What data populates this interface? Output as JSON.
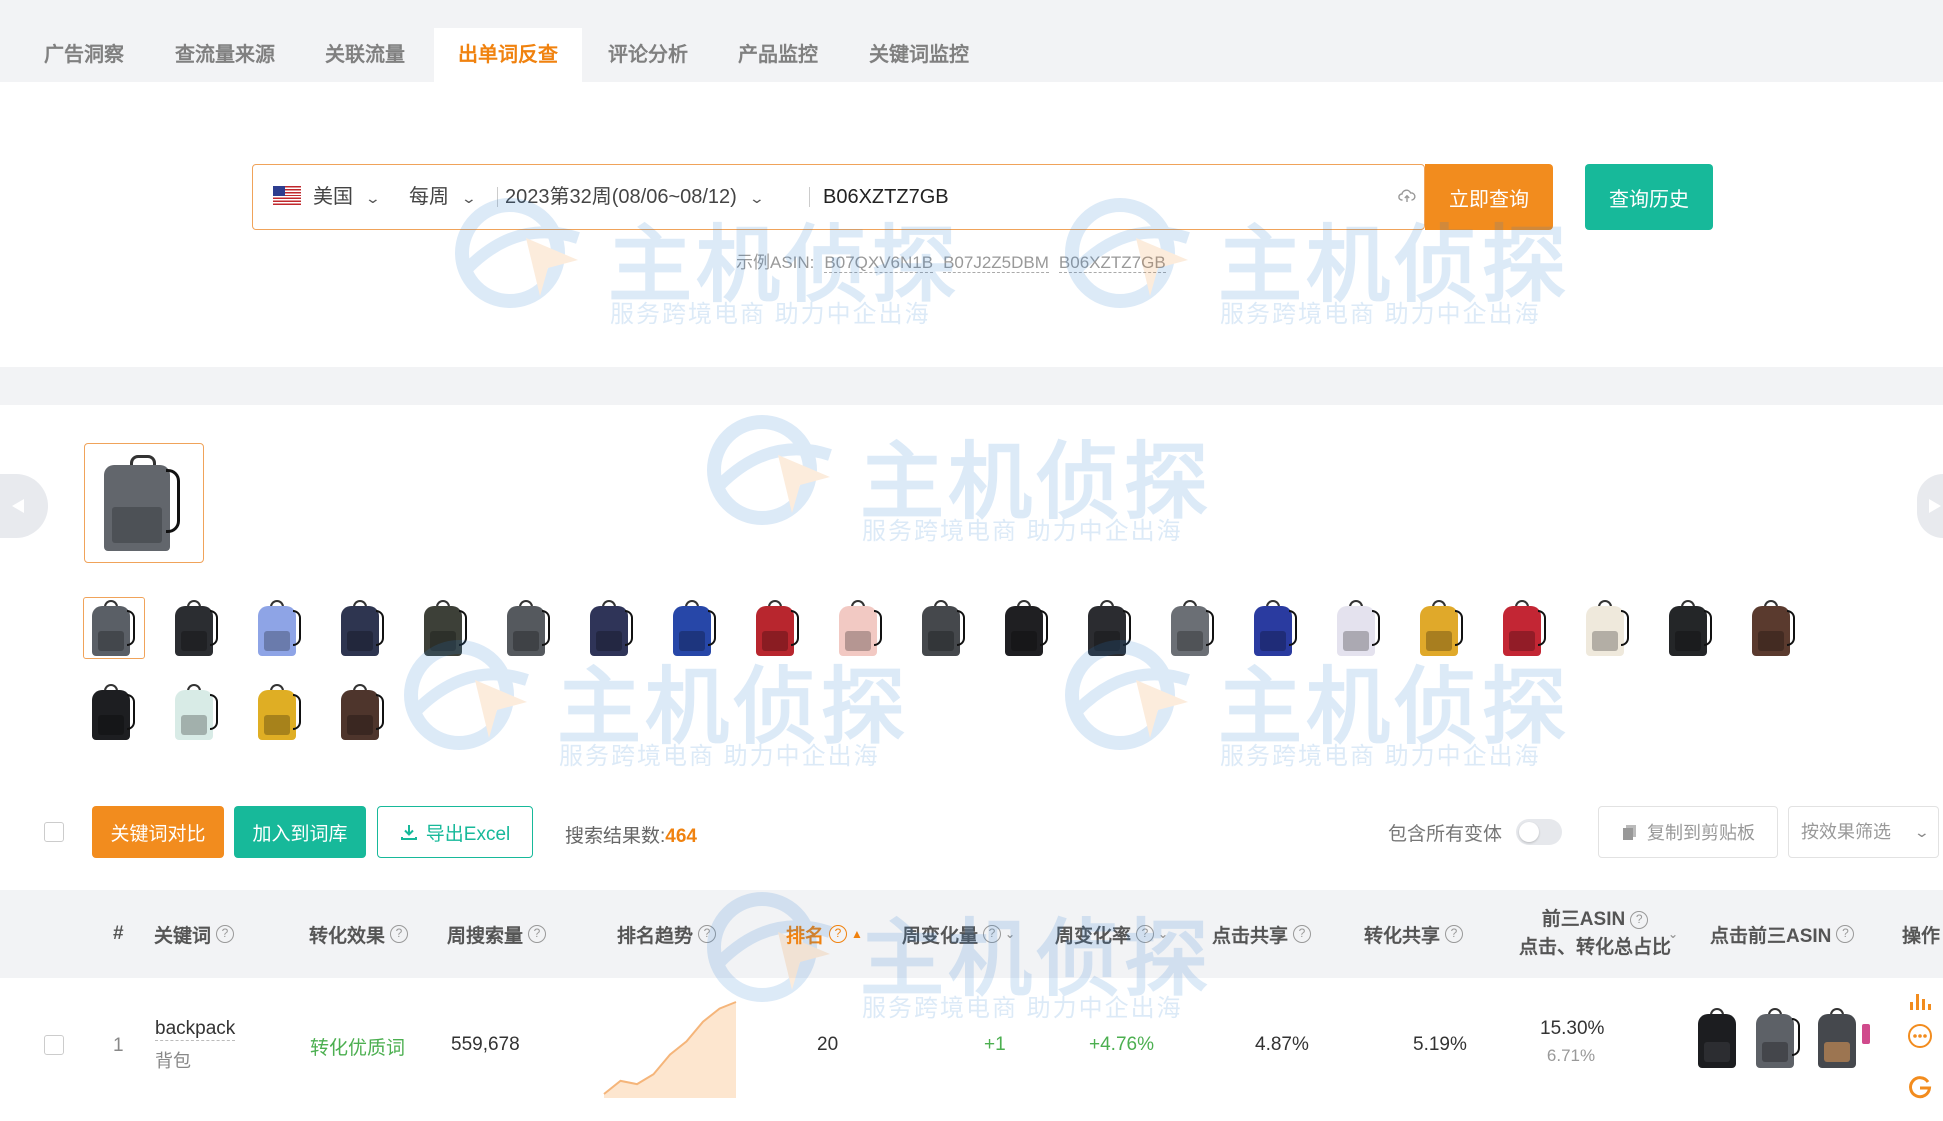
{
  "tabs": [
    {
      "label": "广告洞察",
      "active": false
    },
    {
      "label": "查流量来源",
      "active": false
    },
    {
      "label": "关联流量",
      "active": false
    },
    {
      "label": "出单词反查",
      "active": true
    },
    {
      "label": "评论分析",
      "active": false
    },
    {
      "label": "产品监控",
      "active": false
    },
    {
      "label": "关键词监控",
      "active": false
    }
  ],
  "search": {
    "country": "美国",
    "period": "每周",
    "week": "2023第32周(08/06~08/12)",
    "asin_value": "B06XZTZ7GB",
    "query_button": "立即查询",
    "history_button": "查询历史",
    "examples_label": "示例ASIN:",
    "examples": [
      "B07QXV6N1B",
      "B07J2Z5DBM",
      "B06XZTZ7GB"
    ]
  },
  "watermark": {
    "title": "主机侦探",
    "subtitle": "服务跨境电商  助力中企出海"
  },
  "variant_colors": [
    "#5a5f66",
    "#2b2d31",
    "#8ea4e6",
    "#2e3550",
    "#3d4038",
    "#55595e",
    "#2f3458",
    "#2747a8",
    "#b8262e",
    "#f2c9c3",
    "#45484c",
    "#1f1f22",
    "#2b2c30",
    "#6b6f75",
    "#2a3ba0",
    "#e4e2ee",
    "#e0a92a",
    "#c32634",
    "#efe9dc",
    "#242628",
    "#5a3a2e",
    "#1d1e21",
    "#d8ebe6",
    "#dfae24",
    "#4e352c"
  ],
  "toolbar": {
    "compare": "关键词对比",
    "add_to_library": "加入到词库",
    "export": "导出Excel",
    "result_label": "搜索结果数:",
    "result_count": "464",
    "include_variants": "包含所有变体",
    "copy": "复制到剪贴板",
    "filter": "按效果筛选"
  },
  "table": {
    "headers": {
      "index": "#",
      "keyword": "关键词",
      "conversion_effect": "转化效果",
      "weekly_search": "周搜索量",
      "rank_trend": "排名趋势",
      "rank": "排名",
      "weekly_change": "周变化量",
      "weekly_change_rate": "周变化率",
      "click_share": "点击共享",
      "conversion_share": "转化共享",
      "top3_line1": "前三ASIN",
      "top3_line2": "点击、转化总占比",
      "top3_asin": "点击前三ASIN",
      "action": "操作"
    },
    "rows": [
      {
        "index": "1",
        "keyword": "backpack",
        "keyword_cn": "背包",
        "conversion_effect": "转化优质词",
        "weekly_search": "559,678",
        "rank_trend": [
          30,
          26,
          27,
          24,
          18,
          14,
          8,
          4,
          2
        ],
        "rank": "20",
        "weekly_change": "+1",
        "weekly_change_rate": "+4.76%",
        "click_share": "4.87%",
        "conversion_share": "5.19%",
        "top3_click": "15.30%",
        "top3_conversion": "6.71%"
      }
    ]
  },
  "colors": {
    "accent_orange": "#f28c1e",
    "accent_teal": "#17b99a",
    "positive_green": "#4caf50"
  }
}
